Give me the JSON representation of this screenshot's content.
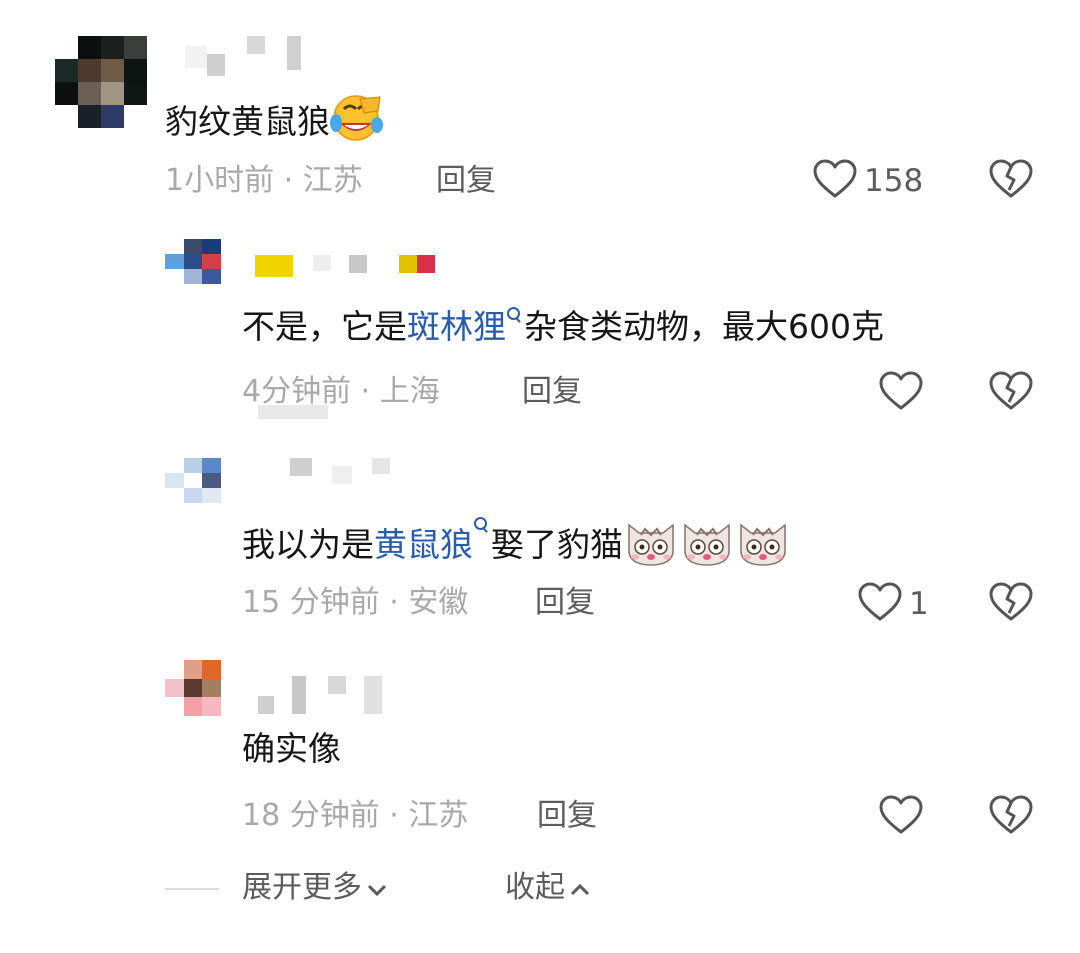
{
  "comments": [
    {
      "text": "豹纹黄鼠狼",
      "time": "1小时前",
      "location": "江苏",
      "reply_label": "回复",
      "like_count": "158",
      "emoji": "laughing-crying-emoji"
    },
    {
      "text_before": "不是，它是",
      "link_text": "斑林狸",
      "text_after": "杂食类动物，最大600克",
      "time": "4分钟前",
      "location": "上海",
      "reply_label": "回复",
      "like_count": ""
    },
    {
      "text_before": "我以为是",
      "link_text": "黄鼠狼",
      "text_after": "娶了豹猫",
      "time": "15 分钟前",
      "location": "安徽",
      "reply_label": "回复",
      "like_count": "1",
      "emoji": "cat-face-emoji"
    },
    {
      "text": "确实像",
      "time": "18 分钟前",
      "location": "江苏",
      "reply_label": "回复",
      "like_count": ""
    }
  ],
  "footer": {
    "expand_label": "展开更多",
    "collapse_label": "收起"
  },
  "colors": {
    "link": "#2a5caa",
    "meta": "#a9a9a9",
    "reply": "#5c5c5c",
    "icon": "#555555"
  },
  "icons": {
    "like": "heart-outline-icon",
    "dislike": "broken-heart-icon",
    "search": "search-icon"
  }
}
